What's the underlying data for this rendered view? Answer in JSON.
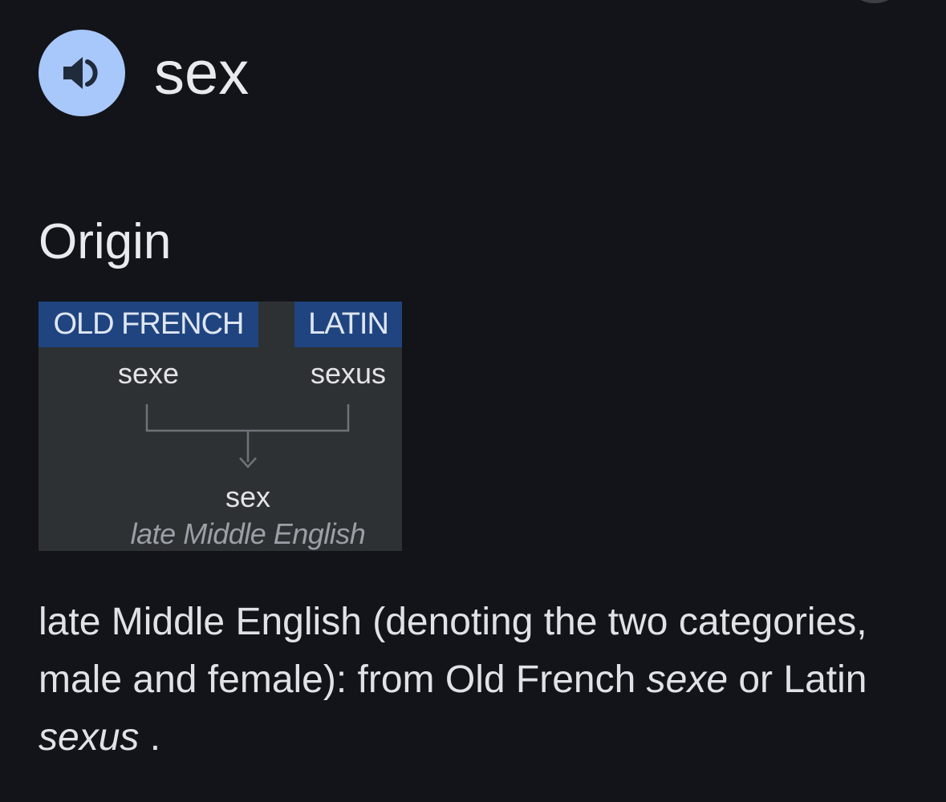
{
  "entry": {
    "word": "sex",
    "audio_icon": "volume-icon"
  },
  "origin": {
    "heading": "Origin",
    "diagram": {
      "sources": [
        {
          "language": "OLD FRENCH",
          "word": "sexe"
        },
        {
          "language": "LATIN",
          "word": "sexus"
        }
      ],
      "result": {
        "word": "sex",
        "period": "late Middle English"
      }
    },
    "text": {
      "part1": "late Middle English (denoting the two categories, male and female): from Old French ",
      "word1": "sexe",
      "part2": " or Latin ",
      "word2": "sexus",
      "part3": " ."
    }
  },
  "colors": {
    "background": "#131419",
    "audio_button": "#a8c7fa",
    "language_tag": "#1f4480",
    "diagram_background": "#2e3134"
  }
}
